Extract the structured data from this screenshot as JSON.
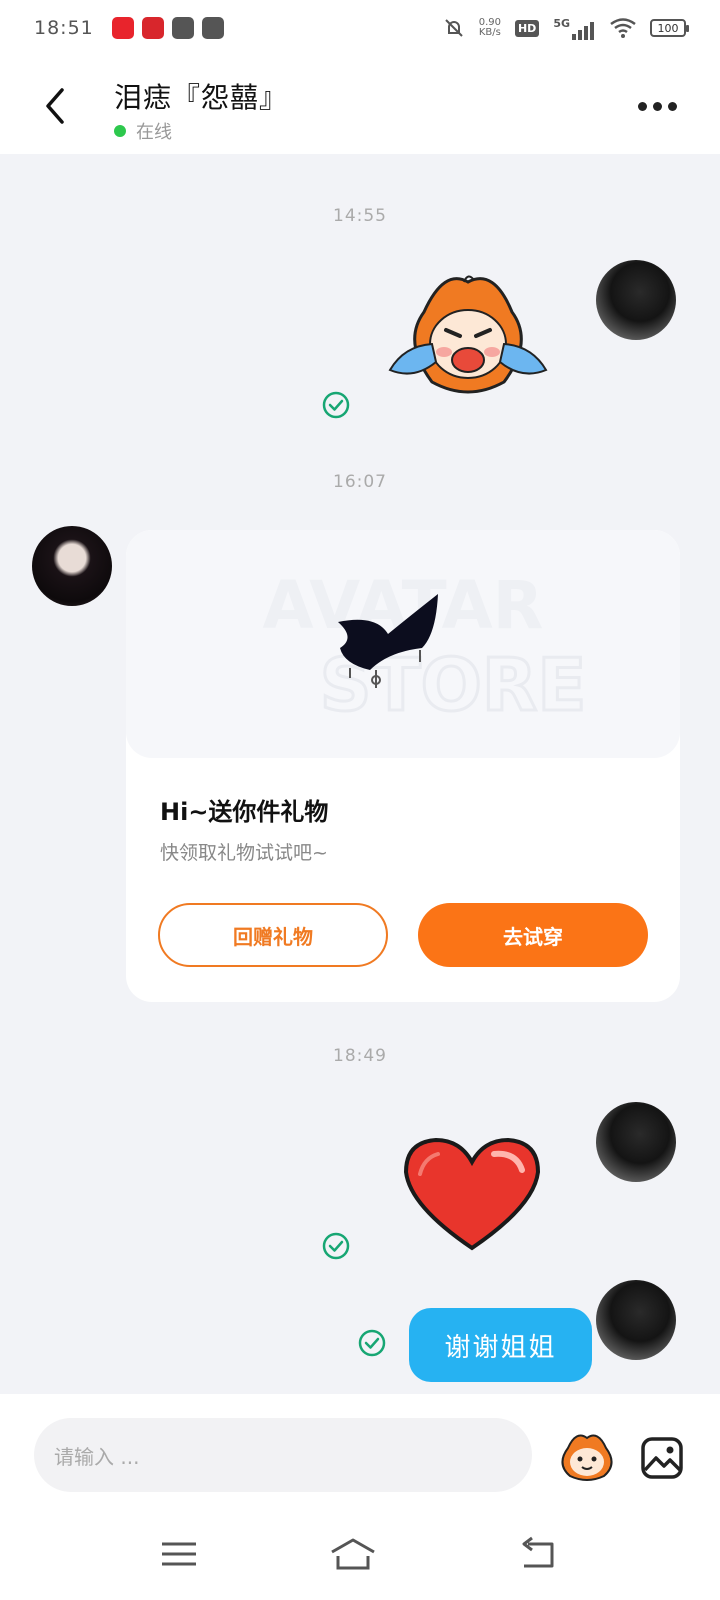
{
  "status_bar": {
    "time": "18:51",
    "network_speed_value": "0.90",
    "network_speed_unit": "KB/s",
    "hd": "HD",
    "signal": "5G",
    "battery": "100",
    "app_icon_colors": [
      "#e8242c",
      "#d8262c",
      "#555555",
      "#555555"
    ]
  },
  "header": {
    "title": "泪痣『怨囍』",
    "status": "在线",
    "status_color": "#2dc84d"
  },
  "timestamps": [
    "14:55",
    "16:07",
    "18:49"
  ],
  "gift_card": {
    "title": "Hi~送你件礼物",
    "subtitle": "快领取礼物试试吧~",
    "watermark_line1": "AVATAR",
    "watermark_line2": "STORE",
    "return_gift_label": "回赠礼物",
    "try_on_label": "去试穿",
    "accent_color": "#fb7416"
  },
  "messages": [
    {
      "side": "right",
      "type": "sticker",
      "sticker": "crying-fox-sticker",
      "status": "read"
    },
    {
      "side": "left",
      "type": "gift-card"
    },
    {
      "side": "right",
      "type": "sticker",
      "sticker": "red-heart-sticker",
      "status": "read"
    },
    {
      "side": "right",
      "type": "text",
      "text": "谢谢姐姐",
      "status": "read"
    }
  ],
  "input_bar": {
    "placeholder": "请输入 ...",
    "emoji_icon": "fox-emoji-icon",
    "image_icon": "image-icon"
  },
  "nav_bar": {
    "items": [
      "menu-icon",
      "home-icon",
      "back-nav-icon"
    ]
  }
}
